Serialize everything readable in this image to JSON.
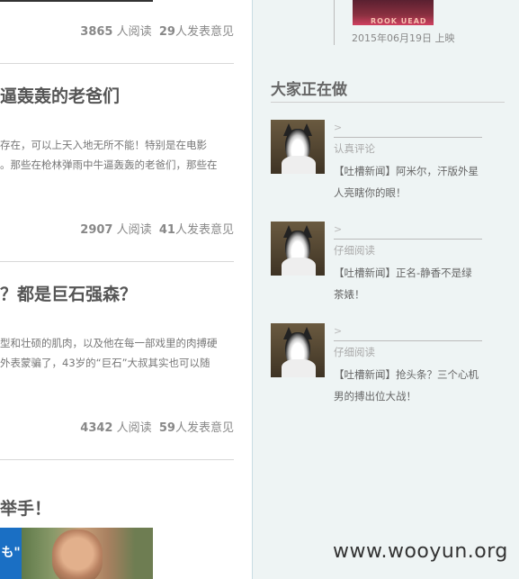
{
  "articles": [
    {
      "reads": "3865",
      "reads_label": "人阅读",
      "comments": "29",
      "comments_label": "人发表意见"
    },
    {
      "title": "逼轰轰的老爸们",
      "summary": [
        "存在，可以上天入地无所不能！特别是在电影",
        "。那些在枪林弹雨中牛逼轰轰的老爸们，那些在"
      ],
      "reads": "2907",
      "reads_label": "人阅读",
      "comments": "41",
      "comments_label": "人发表意见"
    },
    {
      "title": "？都是巨石强森？",
      "summary": [
        "型和壮硕的肌肉，以及他在每一部戏里的肉搏硬",
        "外表蒙骗了，43岁的“巨石”大叔其实也可以随"
      ],
      "reads": "4342",
      "reads_label": "人阅读",
      "comments": "59",
      "comments_label": "人发表意见"
    },
    {
      "title": "举手！",
      "photo_tag": "も\""
    }
  ],
  "movie": {
    "thumb_text": "ROOK UEAD",
    "date": "2015年06月19日 上映"
  },
  "activity_section": {
    "title": "大家正在做",
    "items": [
      {
        "arrow": ">",
        "action": "认真评论",
        "text": "【吐槽新闻】阿米尔，汗版外星人亮瞎你的眼！"
      },
      {
        "arrow": ">",
        "action": "仔细阅读",
        "text": "【吐槽新闻】正名-静香不是绿茶婊！"
      },
      {
        "arrow": ">",
        "action": "仔细阅读",
        "text": "【吐槽新闻】抢头条？三个心机男的搏出位大战！"
      }
    ]
  },
  "watermark": "www.wooyun.org"
}
